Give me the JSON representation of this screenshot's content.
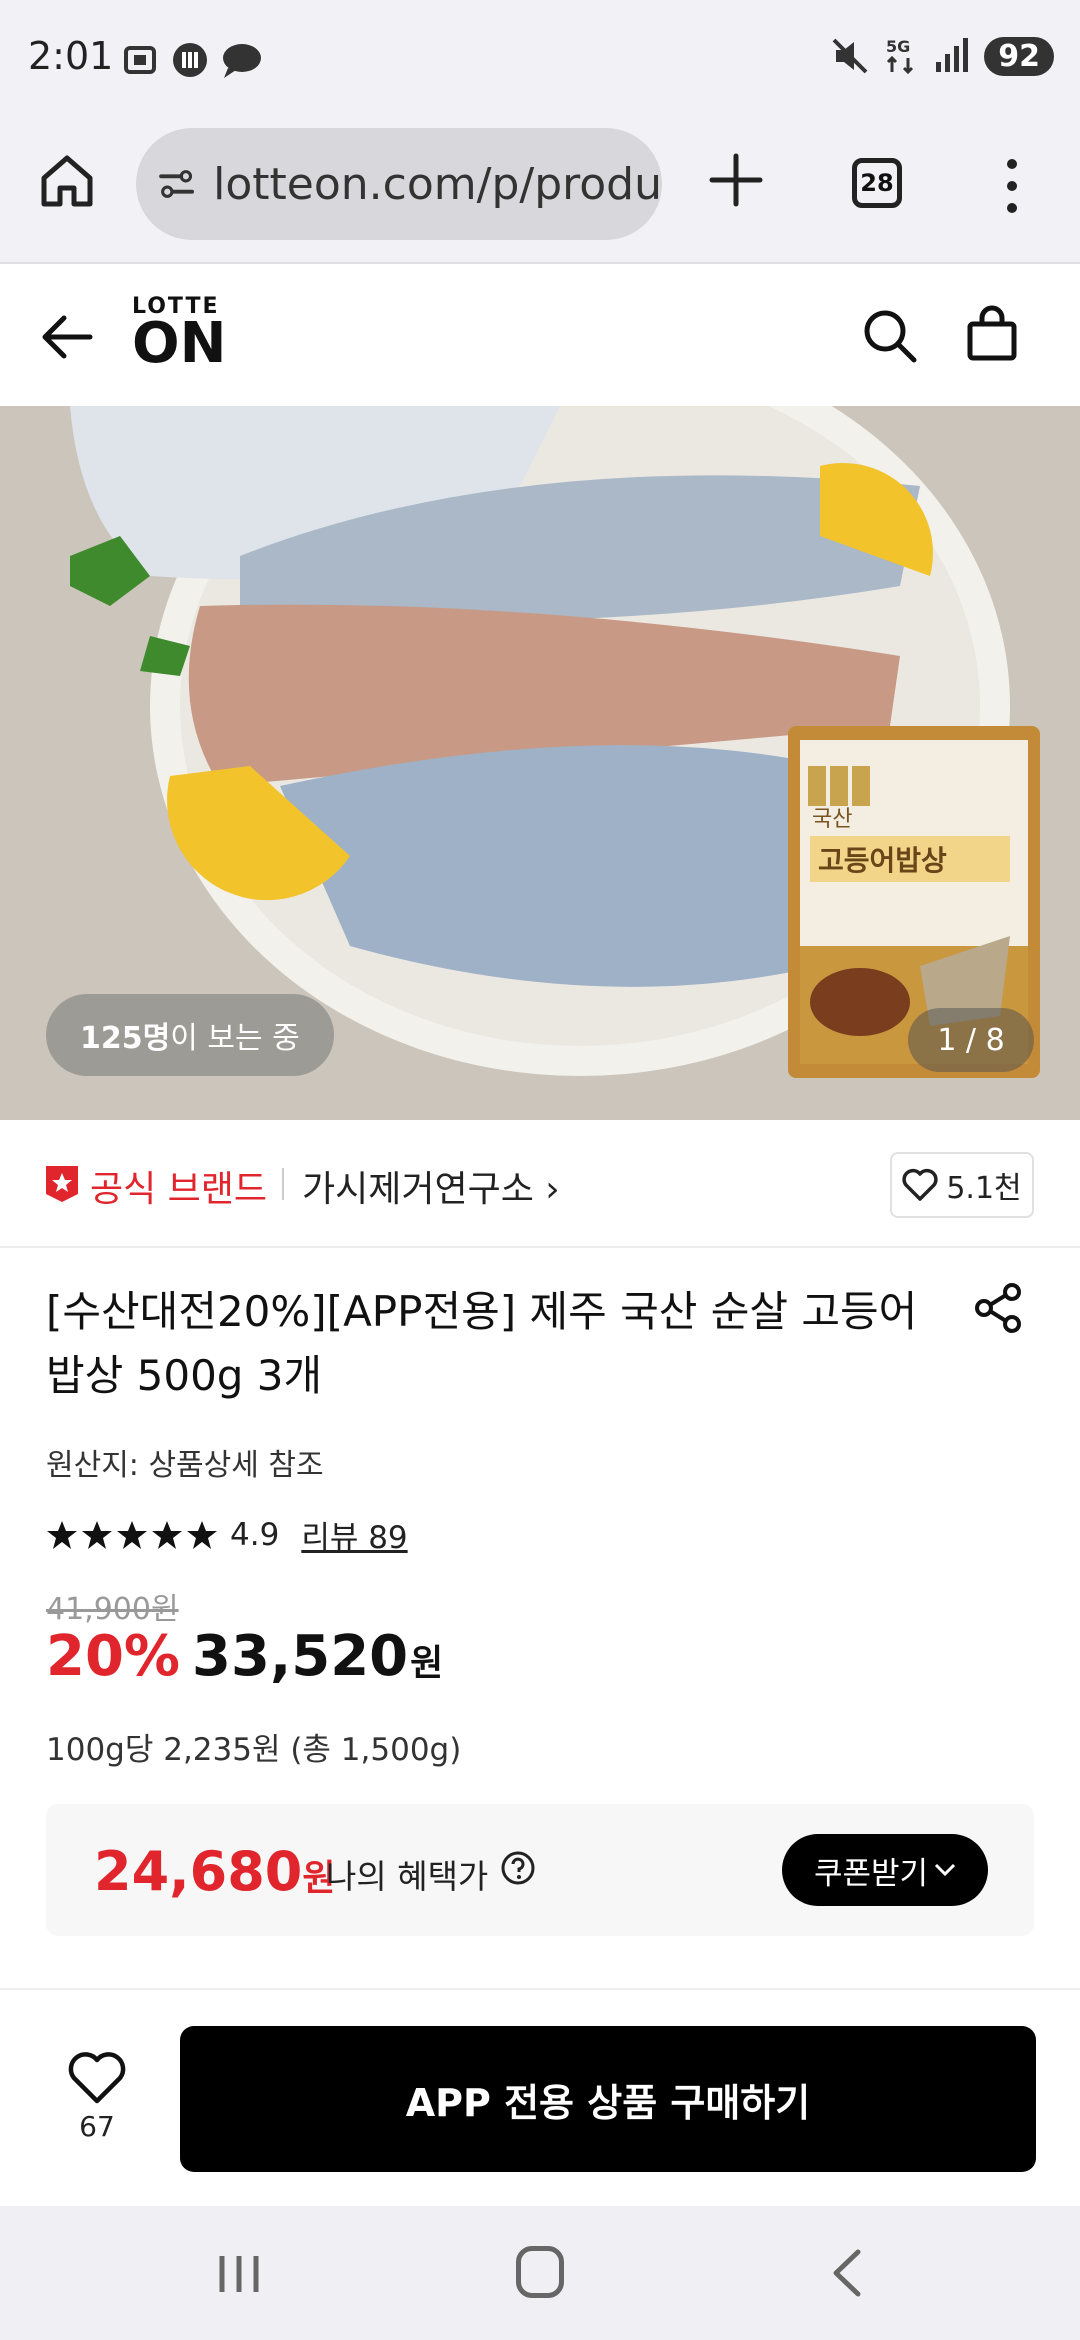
{
  "status_bar": {
    "time": "2:01",
    "battery": "92"
  },
  "browser": {
    "url": "lotteon.com/p/produ",
    "tab_count": "28"
  },
  "app_header": {
    "logo_top": "LOTTE",
    "logo_main": "ON"
  },
  "hero": {
    "viewers_count": "125명",
    "viewers_suffix": "이 보는 중",
    "image_counter": "1 / 8",
    "package_label_top": "국산",
    "package_label_main": "고등어밥상"
  },
  "brand": {
    "official_label": "공식 브랜드",
    "name": "가시제거연구소 ›",
    "wish_count": "5.1천"
  },
  "product": {
    "title": "[수산대전20%][APP전용] 제주 국산 순살 고등어밥상 500g 3개",
    "origin": "원산지: 상품상세 참조",
    "rating": "4.9",
    "rating_stars": 5,
    "review_label": "리뷰 89",
    "original_price": "41,900원",
    "discount_rate": "20%",
    "price": "33,520",
    "price_unit": "원",
    "unit_price": "100g당 2,235원 (총 1,500g)"
  },
  "benefit": {
    "price": "24,680",
    "unit": "원",
    "label": "나의 혜택가",
    "coupon_button": "쿠폰받기"
  },
  "buy_bar": {
    "like_count": "67",
    "buy_button": "APP 전용 상품 구매하기"
  },
  "colors": {
    "accent_red": "#e0252c",
    "black": "#000000"
  }
}
